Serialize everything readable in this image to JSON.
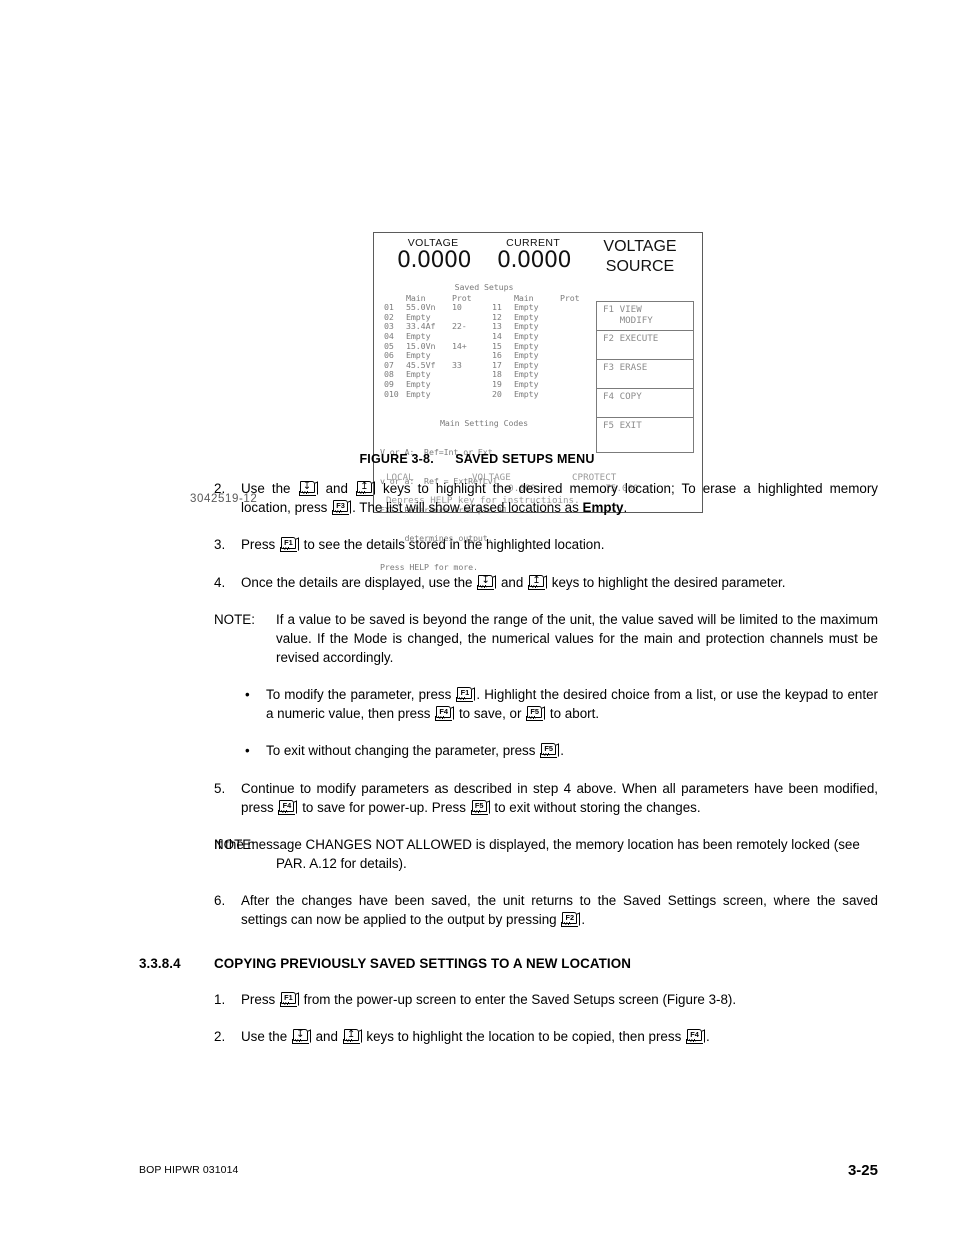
{
  "figure": {
    "drawing_number": "3042519-12",
    "caption_prefix": "FIGURE 3-8.",
    "caption_title": "SAVED SETUPS MENU",
    "lcd": {
      "voltage_label": "VOLTAGE",
      "current_label": "CURRENT",
      "voltage_value": "0.0000",
      "current_value": "0.0000",
      "mode_line1": "VOLTAGE",
      "mode_line2": "SOURCE",
      "setups_title": "Saved Setups",
      "col_head": {
        "idx": "",
        "main": "Main",
        "prot": "Prot",
        "idx2": "",
        "main2": "Main",
        "prot2": "Prot"
      },
      "rows": [
        {
          "idx": "01",
          "main": "55.0Vn",
          "prot": "10",
          "idx2": "11",
          "main2": "Empty",
          "prot2": ""
        },
        {
          "idx": "02",
          "main": "Empty",
          "prot": "",
          "idx2": "12",
          "main2": "Empty",
          "prot2": ""
        },
        {
          "idx": "03",
          "main": "33.4Af",
          "prot": "22-",
          "idx2": "13",
          "main2": "Empty",
          "prot2": ""
        },
        {
          "idx": "04",
          "main": "Empty",
          "prot": "",
          "idx2": "14",
          "main2": "Empty",
          "prot2": ""
        },
        {
          "idx": "05",
          "main": "15.0Vn",
          "prot": "14+",
          "idx2": "15",
          "main2": "Empty",
          "prot2": ""
        },
        {
          "idx": "06",
          "main": "Empty",
          "prot": "",
          "idx2": "16",
          "main2": "Empty",
          "prot2": ""
        },
        {
          "idx": "07",
          "main": "45.5Vf",
          "prot": "33",
          "idx2": "17",
          "main2": "Empty",
          "prot2": ""
        },
        {
          "idx": "08",
          "main": "Empty",
          "prot": "",
          "idx2": "18",
          "main2": "Empty",
          "prot2": ""
        },
        {
          "idx": "09",
          "main": "Empty",
          "prot": "",
          "idx2": "19",
          "main2": "Empty",
          "prot2": ""
        },
        {
          "idx": "010",
          "main": "Empty",
          "prot": "",
          "idx2": "20",
          "main2": "Empty",
          "prot2": ""
        }
      ],
      "codes_title": "Main Setting Codes",
      "codes": [
        "V or A:  Ref=Int or Ext",
        "v or a:  Ref = ExtRefLvl",
        "EXT: Reference from pin 11",
        "     determines output.",
        "Press HELP for more."
      ],
      "fkeys": [
        {
          "label": "F1 VIEW\n   MODIFY"
        },
        {
          "label": "F2 EXECUTE"
        },
        {
          "label": "F3 ERASE"
        },
        {
          "label": "F4 COPY"
        },
        {
          "label": "F5 EXIT"
        }
      ],
      "status": {
        "local": "LOCAL",
        "voltage_label": "VOLTAGE",
        "cprotect_label": "CPROTECT",
        "voltage_value": "0.000",
        "cprotect_value": "75.000",
        "help_line": "Depress HELP key for instructioins."
      }
    }
  },
  "content": {
    "step2": {
      "marker": "2.",
      "t1": "Use the ",
      "key_down": "down-arrow",
      "t2": " and ",
      "key_up": "up-arrow",
      "t3": " keys to highlight the desired memory location; To erase a highlighted memory location, press ",
      "key_f3": "F3",
      "t4": ". The list will show erased locations as ",
      "bold_empty": "Empty",
      "t5": "."
    },
    "step3": {
      "marker": "3.",
      "t1": "Press ",
      "key_f1": "F1",
      "t2": " to see the details stored in the highlighted location."
    },
    "step4": {
      "marker": "4.",
      "t1": "Once the details are displayed, use the ",
      "key_down": "down-arrow",
      "t2": " and ",
      "key_up": "up-arrow",
      "t3": " keys to highlight the desired parameter."
    },
    "note1": {
      "marker": "NOTE:",
      "text": "If a value to be saved is beyond the range of the unit, the value saved will be limited to the maximum value. If the Mode is changed, the numerical values for the main and protection channels must be revised accordingly."
    },
    "bullet1": {
      "marker": "•",
      "t1": "To modify the parameter, press ",
      "key_f1": "F1",
      "t2": ". Highlight the desired choice from a list, or use the keypad to enter a numeric value, then press ",
      "key_f4": "F4",
      "t3": " to save, or ",
      "key_f5": "F5",
      "t4": " to abort."
    },
    "bullet2": {
      "marker": "•",
      "t1": "To exit without changing the parameter, press ",
      "key_f5": "F5",
      "t2": "."
    },
    "step5": {
      "marker": "5.",
      "t1": "Continue to modify parameters as described in step 4 above. When all parameters have been modified, press ",
      "key_f4": "F4",
      "t2": " to save for power-up. Press ",
      "key_f5": "F5",
      "t3": " to exit without storing the changes."
    },
    "note2": {
      "marker": "NOTE:",
      "line1": "If the message CHANGES NOT ALLOWED is displayed, the memory location has been",
      "line2": "remotely locked (see PAR. A.12 for details)."
    },
    "step6": {
      "marker": "6.",
      "t1": "After the changes have been saved, the unit returns to the Saved Settings screen, where the saved settings can now be applied to the output by pressing ",
      "key_f2": "F2",
      "t2": "."
    },
    "section": {
      "number": "3.3.8.4",
      "title": "COPYING PREVIOUSLY SAVED SETTINGS TO A NEW LOCATION"
    },
    "copy1": {
      "marker": "1.",
      "t1": "Press ",
      "key_f1": "F1",
      "t2": " from the power-up screen to enter the Saved Setups screen (Figure 3-8)."
    },
    "copy2": {
      "marker": "2.",
      "t1": "Use the ",
      "key_down": "down-arrow",
      "t2": " and ",
      "key_up": "up-arrow",
      "t3": " keys to highlight the location to be copied, then press ",
      "key_f4": "F4",
      "t4": "."
    }
  },
  "footer": {
    "left": "BOP HIPWR 031014",
    "page": "3-25"
  }
}
